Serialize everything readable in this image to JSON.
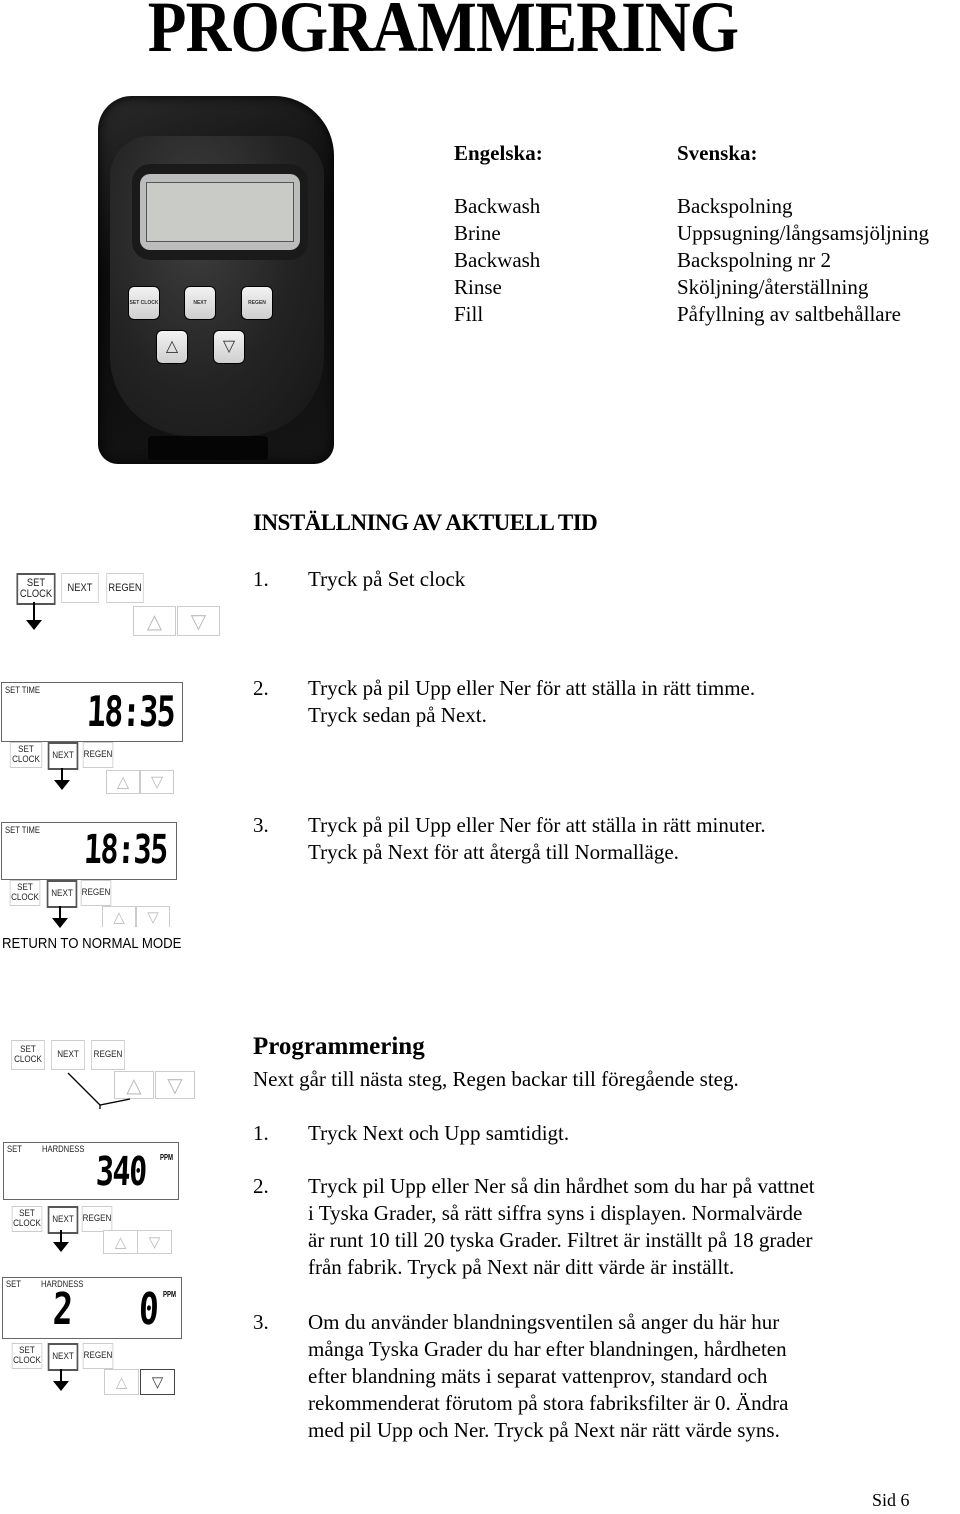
{
  "page_title": "PROGRAMMERING",
  "device": {
    "buttons": [
      {
        "id": "set_clock",
        "label": "SET CLOCK"
      },
      {
        "id": "next",
        "label": "NEXT"
      },
      {
        "id": "regen",
        "label": "REGEN"
      }
    ],
    "up_icon": "△",
    "down_icon": "▽"
  },
  "glossary": {
    "header_en": "Engelska:",
    "header_sv": "Svenska:",
    "rows": [
      {
        "en": "Backwash",
        "sv": "Backspolning"
      },
      {
        "en": "Brine",
        "sv": "Uppsugning/långsamsjöljning"
      },
      {
        "en": "Backwash",
        "sv": "Backspolning nr 2"
      },
      {
        "en": "Rinse",
        "sv": "Sköljning/återställning"
      },
      {
        "en": "Fill",
        "sv": "Påfyllning av saltbehållare"
      }
    ]
  },
  "section_time": {
    "heading": "INSTÄLLNING AV AKTUELL TID",
    "steps": [
      {
        "num": "1.",
        "lines": [
          "Tryck på Set clock"
        ]
      },
      {
        "num": "2.",
        "lines": [
          "Tryck på pil Upp eller Ner för att ställa in rätt timme.",
          "Tryck sedan på Next."
        ]
      },
      {
        "num": "3.",
        "lines": [
          "Tryck på pil Upp eller Ner för att ställa in rätt minuter.",
          "Tryck på Next för att återgå till Normalläge."
        ]
      }
    ]
  },
  "panels": {
    "set_label": "SET",
    "clock_label": "CLOCK",
    "next_label": "NEXT",
    "regen_label": "REGEN",
    "up_icon": "△",
    "down_icon": "▽",
    "set_time_label": "SET TIME",
    "time_value": "18:35",
    "hardness_set_label": "SET",
    "hardness_label": "HARDNESS",
    "hardness_value": "340",
    "ppm_label": "PPM",
    "blend_left_value": "2",
    "blend_right_value": "0",
    "return_text": "RETURN TO NORMAL MODE"
  },
  "section_prog": {
    "heading": "Programmering",
    "intro": "Next går till nästa steg, Regen backar till föregående steg.",
    "steps": [
      {
        "num": "1.",
        "lines": [
          "Tryck Next och Upp samtidigt."
        ]
      },
      {
        "num": "2.",
        "lines": [
          "Tryck pil Upp eller Ner så din hårdhet som du har på vattnet",
          "i Tyska Grader, så rätt siffra syns i displayen. Normalvärde",
          "är runt 10 till 20 tyska Grader. Filtret är inställt på 18 grader",
          "från fabrik. Tryck på Next när ditt värde är inställt."
        ]
      },
      {
        "num": "3.",
        "lines": [
          "Om du använder blandningsventilen så anger du här hur",
          "många Tyska Grader du har efter blandningen, hårdheten",
          "efter blandning mäts i separat vattenprov, standard och",
          "rekommenderat förutom på stora fabriksfilter är 0. Ändra",
          "med pil Upp och Ner. Tryck på Next när rätt värde syns."
        ]
      }
    ]
  },
  "footer": {
    "page_label": "Sid 6"
  }
}
